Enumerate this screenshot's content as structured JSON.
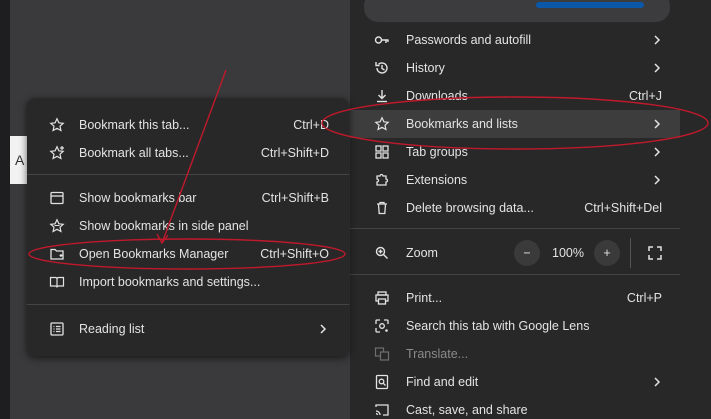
{
  "background_page": {
    "letter": "A"
  },
  "main_menu": {
    "items": [
      {
        "label": "Passwords and autofill",
        "shortcut": "",
        "icon": "key-icon",
        "submenu": true
      },
      {
        "label": "History",
        "shortcut": "",
        "icon": "history-icon",
        "submenu": true
      },
      {
        "label": "Downloads",
        "shortcut": "Ctrl+J",
        "icon": "download-icon",
        "submenu": false
      },
      {
        "label": "Bookmarks and lists",
        "shortcut": "",
        "icon": "star-icon",
        "submenu": true,
        "highlighted": true
      },
      {
        "label": "Tab groups",
        "shortcut": "",
        "icon": "tab-groups-icon",
        "submenu": true
      },
      {
        "label": "Extensions",
        "shortcut": "",
        "icon": "puzzle-icon",
        "submenu": true
      },
      {
        "label": "Delete browsing data...",
        "shortcut": "Ctrl+Shift+Del",
        "icon": "trash-icon",
        "submenu": false
      }
    ],
    "zoom": {
      "label": "Zoom",
      "minus": "−",
      "value": "100%",
      "plus": "+"
    },
    "items2": [
      {
        "label": "Print...",
        "shortcut": "Ctrl+P",
        "icon": "print-icon"
      },
      {
        "label": "Search this tab with Google Lens",
        "shortcut": "",
        "icon": "lens-icon"
      },
      {
        "label": "Translate...",
        "shortcut": "",
        "icon": "translate-icon",
        "disabled": true
      },
      {
        "label": "Find and edit",
        "shortcut": "",
        "icon": "find-icon",
        "submenu": true
      },
      {
        "label": "Cast, save, and share",
        "shortcut": "",
        "icon": "cast-icon",
        "submenu": true
      }
    ]
  },
  "bookmarks_submenu": {
    "items": [
      {
        "label": "Bookmark this tab...",
        "shortcut": "Ctrl+D",
        "icon": "star-icon"
      },
      {
        "label": "Bookmark all tabs...",
        "shortcut": "Ctrl+Shift+D",
        "icon": "star-add-icon"
      },
      {
        "label": "Show bookmarks bar",
        "shortcut": "Ctrl+Shift+B",
        "icon": "bookmarks-bar-icon"
      },
      {
        "label": "Show bookmarks in side panel",
        "shortcut": "",
        "icon": "side-panel-star-icon"
      },
      {
        "label": "Open Bookmarks Manager",
        "shortcut": "Ctrl+Shift+O",
        "icon": "folder-open-icon"
      },
      {
        "label": "Import bookmarks and settings...",
        "shortcut": "",
        "icon": "import-icon"
      },
      {
        "label": "Reading list",
        "shortcut": "",
        "icon": "reading-list-icon",
        "submenu": true
      }
    ]
  },
  "annotation_color": "#c0192c"
}
